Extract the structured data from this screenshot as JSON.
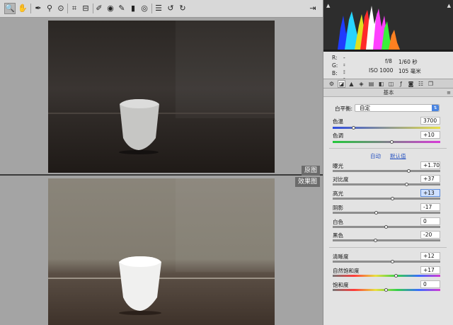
{
  "toolbar": {
    "tools": [
      {
        "name": "zoom-tool",
        "glyph": "🔍"
      },
      {
        "name": "hand-tool",
        "glyph": "✋"
      },
      {
        "name": "white-balance-tool",
        "glyph": "✒"
      },
      {
        "name": "color-sampler-tool",
        "glyph": "⚲"
      },
      {
        "name": "target-adjustment-tool",
        "glyph": "⊙"
      },
      {
        "name": "crop-tool",
        "glyph": "⌗"
      },
      {
        "name": "straighten-tool",
        "glyph": "⊟"
      },
      {
        "name": "spot-removal-tool",
        "glyph": "✐"
      },
      {
        "name": "red-eye-tool",
        "glyph": "◉"
      },
      {
        "name": "adjustment-brush-tool",
        "glyph": "✎"
      },
      {
        "name": "graduated-filter-tool",
        "glyph": "▮"
      },
      {
        "name": "radial-filter-tool",
        "glyph": "◎"
      },
      {
        "name": "preferences-tool",
        "glyph": "☰"
      },
      {
        "name": "rotate-left-tool",
        "glyph": "↺"
      },
      {
        "name": "rotate-right-tool",
        "glyph": "↻"
      }
    ],
    "fullscreen_glyph": "⇥"
  },
  "preview": {
    "before_label": "原图",
    "after_label": "效果图"
  },
  "info": {
    "r_label": "R:",
    "r_value": "---",
    "g_label": "G:",
    "g_value": "---",
    "b_label": "B:",
    "b_value": "---",
    "aperture": "f/8",
    "shutter": "1/60 秒",
    "iso": "ISO 1000",
    "focal": "105 毫米"
  },
  "panel": {
    "section_title": "基本",
    "white_balance_label": "白平衡:",
    "white_balance_value": "自定",
    "auto_link": "自动",
    "default_link": "默认值"
  },
  "adjustments": {
    "temperature": {
      "label": "色温",
      "value": "3700",
      "position": 0.2
    },
    "tint": {
      "label": "色调",
      "value": "+10",
      "position": 0.55
    },
    "exposure": {
      "label": "曝光",
      "value": "+1.70",
      "position": 0.71
    },
    "contrast": {
      "label": "对比度",
      "value": "+37",
      "position": 0.69
    },
    "highlights": {
      "label": "高光",
      "value": "+13",
      "position": 0.56
    },
    "shadows": {
      "label": "阴影",
      "value": "-17",
      "position": 0.41
    },
    "whites": {
      "label": "白色",
      "value": "0",
      "position": 0.5
    },
    "blacks": {
      "label": "黑色",
      "value": "-20",
      "position": 0.4
    },
    "clarity": {
      "label": "清晰度",
      "value": "+12",
      "position": 0.56
    },
    "vibrance": {
      "label": "自然饱和度",
      "value": "+17",
      "position": 0.59
    },
    "saturation": {
      "label": "饱和度",
      "value": "0",
      "position": 0.5
    }
  },
  "colors": {
    "link": "#2b56c2",
    "selection": "#cfe0ff"
  }
}
